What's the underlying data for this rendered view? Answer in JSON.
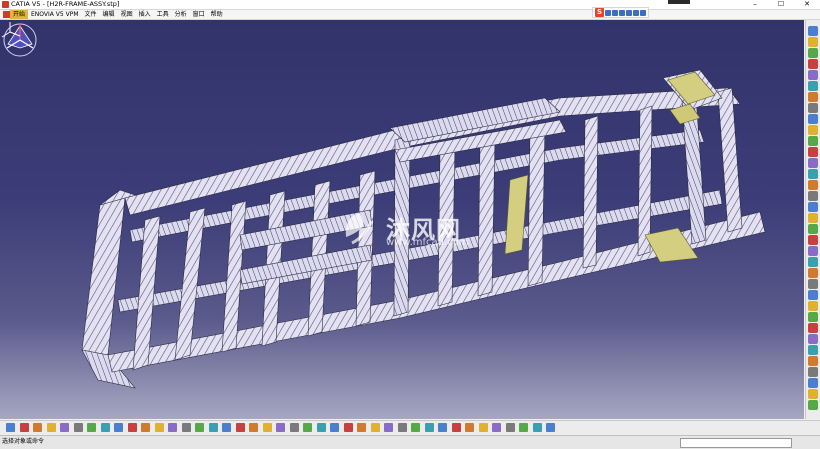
{
  "window": {
    "title": "CATIA V5 - [H2R-FRAME-ASSY.stp]",
    "controls": {
      "minimize": "–",
      "restore": "☐",
      "close": "✕"
    }
  },
  "menubar": {
    "items": [
      "开始",
      "ENOVIA V5 VPM",
      "文件",
      "编辑",
      "视图",
      "插入",
      "工具",
      "分析",
      "窗口",
      "帮助"
    ]
  },
  "viewport": {
    "background_top": "#33336b",
    "background_bottom": "#a7a7c2",
    "model_color": "#e8e6f4",
    "highlight_color": "#d8d07a"
  },
  "watermark": {
    "text": "沐风网",
    "url": "www.mfcad.com"
  },
  "ime_toolbar": {
    "logo": "S"
  },
  "status": {
    "message": "选择对象或命令"
  },
  "icons": {
    "right": [
      "sketcher-icon",
      "part-icon",
      "pad-icon",
      "pocket-icon",
      "shaft-icon",
      "groove-icon",
      "hole-icon",
      "rib-icon",
      "slot-icon",
      "loft-icon",
      "fillet-icon",
      "chamfer-icon",
      "draft-icon",
      "shell-icon",
      "thickness-icon",
      "thread-icon",
      "boolean-icon",
      "constraint-icon",
      "plane-icon",
      "point-icon",
      "line-icon",
      "measure-icon",
      "parameter-icon",
      "formula-icon",
      "catalog-icon",
      "apply-material-icon",
      "render-icon",
      "analysis-icon",
      "assembly-icon",
      "product-icon",
      "snap-icon",
      "mirror-icon",
      "pattern-icon",
      "scale-icon",
      "translate-icon"
    ],
    "bottom": [
      "new-icon",
      "open-icon",
      "save-icon",
      "print-icon",
      "cut-icon",
      "copy-icon",
      "paste-icon",
      "undo-icon",
      "redo-icon",
      "whats-this-icon",
      "formula-icon",
      "catalog-icon",
      "view-icon",
      "render-style-icon",
      "hide-show-icon",
      "swap-icon",
      "fly-icon",
      "fit-all-icon",
      "pan-icon",
      "rotate-icon",
      "zoom-in-icon",
      "zoom-out-icon",
      "normal-view-icon",
      "iso-view-icon",
      "shading-icon",
      "hide-icon",
      "multi-view-icon",
      "measure-icon",
      "compass-icon",
      "analysis-icon",
      "snap-icon",
      "update-icon",
      "sketch-icon",
      "section-icon",
      "clash-icon",
      "distance-icon",
      "annotation-icon",
      "material-icon",
      "knowledge-icon",
      "publication-icon",
      "macro-icon"
    ]
  }
}
